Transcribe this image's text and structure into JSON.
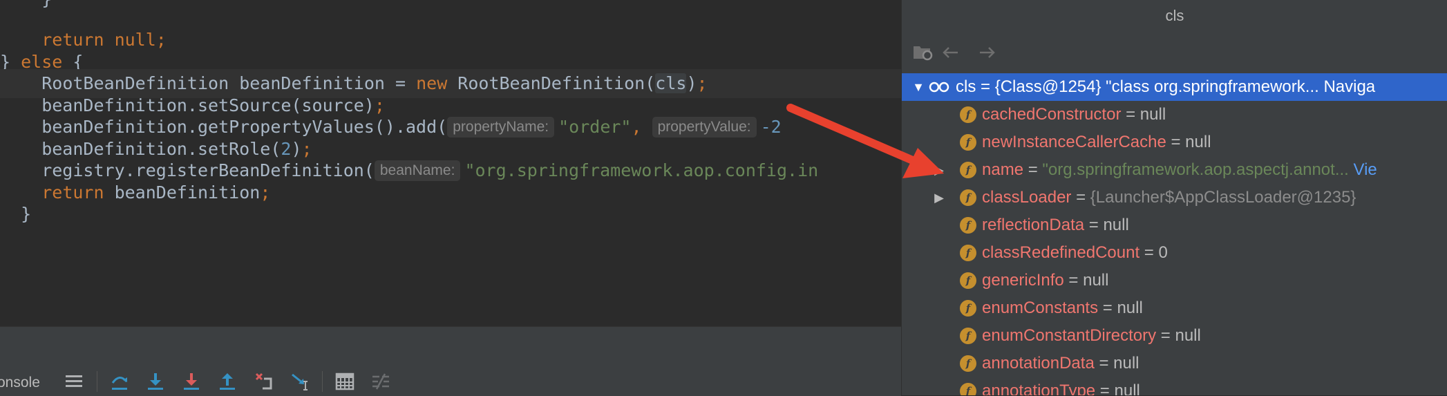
{
  "editor": {
    "lines": [
      {
        "indent": "    ",
        "kw": "return",
        "rest": " null",
        "semi": ";"
      },
      {
        "brace_close": "} ",
        "kw": "else",
        "rest": " {"
      },
      {
        "indent": "    ",
        "type": "RootBeanDefinition",
        "var": " beanDefinition = ",
        "kw": "new",
        "ctor": " RootBeanDefinition(",
        "arg": "cls",
        "end": ")",
        "semi": ";"
      },
      {
        "code": "    beanDefinition.setSource(source)",
        "semi": ";"
      },
      {
        "code": "    beanDefinition.getPropertyValues().add(",
        "hint1": "propertyName:",
        "str1": "\"order\"",
        "comma": ", ",
        "hint2": "propertyValue:",
        "num": "-2"
      },
      {
        "code": "    beanDefinition.setRole(",
        "num": "2",
        "end": ")",
        "semi": ";"
      },
      {
        "code": "    registry.registerBeanDefinition(",
        "hint": "beanName:",
        "str": "\"org.springframework.aop.config.in"
      },
      {
        "indent": "    ",
        "kw": "return",
        "rest": " beanDefinition",
        "semi": ";"
      },
      {
        "brace": "}"
      }
    ]
  },
  "debug_toolbar": {
    "console_label": "onsole",
    "buttons": [
      "menu-icon",
      "step-over-icon",
      "step-into-icon",
      "force-step-into-icon",
      "step-out-icon",
      "drop-frame-icon",
      "run-to-cursor-icon",
      "evaluate-expression-icon",
      "trace-icon"
    ]
  },
  "popup": {
    "title": "cls",
    "root": {
      "name": "cls",
      "value": "= {Class@1254} \"class org.springframework... Naviga"
    },
    "fields": [
      {
        "name": "cachedConstructor",
        "eq": " = ",
        "value": "null",
        "kind": "plain",
        "expandable": false
      },
      {
        "name": "newInstanceCallerCache",
        "eq": " = ",
        "value": "null",
        "kind": "plain",
        "expandable": false
      },
      {
        "name": "name",
        "eq": " = ",
        "value": "\"org.springframework.aop.aspectj.annot...",
        "link": " Vie",
        "kind": "str",
        "expandable": true
      },
      {
        "name": "classLoader",
        "eq": " = ",
        "value": "{Launcher$AppClassLoader@1235}",
        "kind": "gray",
        "expandable": true
      },
      {
        "name": "reflectionData",
        "eq": " = ",
        "value": "null",
        "kind": "plain",
        "expandable": false
      },
      {
        "name": "classRedefinedCount",
        "eq": " = ",
        "value": "0",
        "kind": "plain",
        "expandable": false
      },
      {
        "name": "genericInfo",
        "eq": " = ",
        "value": "null",
        "kind": "plain",
        "expandable": false
      },
      {
        "name": "enumConstants",
        "eq": " = ",
        "value": "null",
        "kind": "plain",
        "expandable": false
      },
      {
        "name": "enumConstantDirectory",
        "eq": " = ",
        "value": "null",
        "kind": "plain",
        "expandable": false
      },
      {
        "name": "annotationData",
        "eq": " = ",
        "value": "null",
        "kind": "plain",
        "expandable": false
      },
      {
        "name": "annotationType",
        "eq": " = ",
        "value": "null",
        "kind": "plain",
        "expandable": false
      }
    ]
  },
  "colors": {
    "annotation_arrow": "#e8412e",
    "selection": "#2f65ca",
    "field_icon": "#c58f2e"
  }
}
